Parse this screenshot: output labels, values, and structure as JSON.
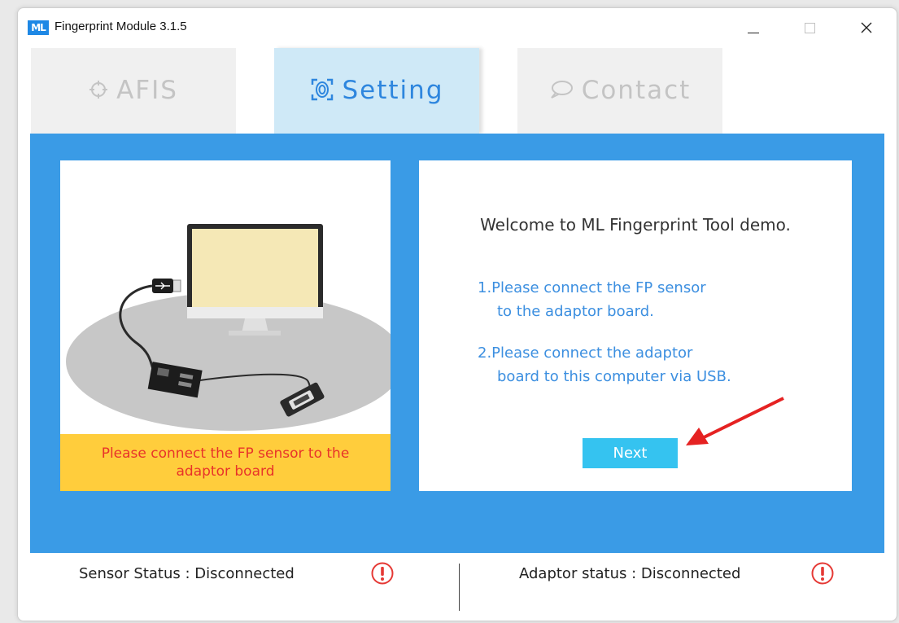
{
  "window": {
    "logo_text": "ML",
    "title": "Fingerprint Module 3.1.5"
  },
  "tabs": [
    {
      "label": "AFIS",
      "icon": "crosshair-icon",
      "active": false
    },
    {
      "label": "Setting",
      "icon": "fingerprint-scan-icon",
      "active": true
    },
    {
      "label": "Contact",
      "icon": "speech-bubble-icon",
      "active": false
    }
  ],
  "left_panel": {
    "caption_line1": "Please connect the FP sensor to the",
    "caption_line2": "adaptor board"
  },
  "right_panel": {
    "welcome": "Welcome to ML Fingerprint Tool demo.",
    "step1_line1": "1.Please connect the FP sensor",
    "step1_line2": "to the adaptor board.",
    "step2_line1": "2.Please connect the adaptor",
    "step2_line2": "board to this computer via USB.",
    "next_label": "Next"
  },
  "status": {
    "sensor": "Sensor Status : Disconnected",
    "adaptor": "Adaptor status : Disconnected"
  },
  "colors": {
    "content_bg": "#3a9be6",
    "active_tab_bg": "#cfe9f7",
    "caption_bg": "#ffcd3c",
    "caption_text": "#e8332a",
    "next_button": "#35c3f0",
    "status_alert": "#e53935"
  }
}
